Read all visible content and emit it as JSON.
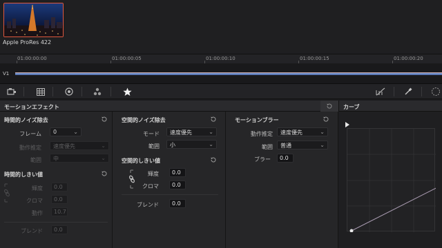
{
  "media_pool": {
    "clip_name": "Apple ProRes 422"
  },
  "timeline": {
    "timecodes": [
      "01:00:00:00",
      "01:00:00:05",
      "01:00:00:10",
      "01:00:00:15",
      "01:00:00:20"
    ],
    "track_label": "V1"
  },
  "toolbar": {
    "left_icons": [
      "camera-icon",
      "grid-icon",
      "target-icon",
      "nodes-icon",
      "star-icon"
    ],
    "right_icons": [
      "curve-tool-icon",
      "eyedropper-icon",
      "circle-dashed-icon"
    ]
  },
  "motion_panel": {
    "title": "モーションエフェクト"
  },
  "temporal_nr": {
    "title": "時間的ノイズ除去",
    "frames_label": "フレーム",
    "frames_value": "0",
    "motion_est_label": "動作推定",
    "motion_est_value": "速度優先",
    "range_label": "範囲",
    "range_value": "中"
  },
  "temporal_threshold": {
    "title": "時間的しきい値",
    "luma_label": "輝度",
    "luma_value": "0.0",
    "chroma_label": "クロマ",
    "chroma_value": "0.0",
    "motion_label": "動作",
    "motion_value": "10.7",
    "blend_label": "ブレンド",
    "blend_value": "0.0"
  },
  "spatial_nr": {
    "title": "空間的ノイズ除去",
    "mode_label": "モード",
    "mode_value": "速度優先",
    "range_label": "範囲",
    "range_value": "小"
  },
  "spatial_threshold": {
    "title": "空間的しきい値",
    "luma_label": "輝度",
    "luma_value": "0.0",
    "chroma_label": "クロマ",
    "chroma_value": "0.0",
    "blend_label": "ブレンド",
    "blend_value": "0.0"
  },
  "motion_blur": {
    "title": "モーションブラー",
    "motion_est_label": "動作推定",
    "motion_est_value": "速度優先",
    "range_label": "範囲",
    "range_value": "普通",
    "blur_label": "ブラー",
    "blur_value": "0.0"
  },
  "curves": {
    "title": "カーブ"
  },
  "colors": {
    "accent": "#e0583e",
    "track": "#5f7fc0"
  }
}
